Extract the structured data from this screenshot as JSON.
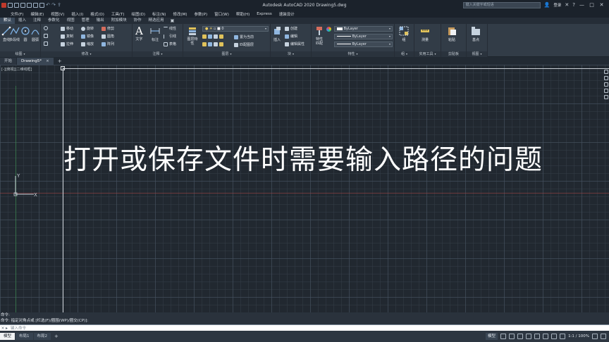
{
  "title_bar": {
    "app_title": "Autodesk AutoCAD 2020    Drawing5.dwg",
    "search_placeholder": "键入关键字或短语",
    "login_label": "登录",
    "help_glyph": "?",
    "minimize_glyph": "—",
    "maximize_glyph": "□",
    "close_glyph": "✕"
  },
  "menu_bar": {
    "items": [
      "文件(F)",
      "编辑(E)",
      "视图(V)",
      "插入(I)",
      "格式(O)",
      "工具(T)",
      "绘图(D)",
      "标注(N)",
      "修改(M)",
      "参数(P)",
      "窗口(W)",
      "帮助(H)",
      "Express",
      "速装设计"
    ]
  },
  "ribbon_tabs": {
    "items": [
      "默认",
      "插入",
      "注释",
      "参数化",
      "视图",
      "管理",
      "输出",
      "附加模块",
      "协作",
      "精选应用"
    ],
    "active_index": 0,
    "toggle_glyph": "▣"
  },
  "ribbon": {
    "draw": {
      "label": "绘图",
      "line": "直线",
      "polyline": "多段线",
      "circle": "圆",
      "arc": "圆弧"
    },
    "modify": {
      "label": "修改",
      "move": "移动",
      "rotate": "旋转",
      "trim": "修剪",
      "copy": "复制",
      "mirror": "镜像",
      "fillet": "圆角",
      "stretch": "拉伸",
      "scale": "缩放",
      "array": "阵列"
    },
    "annotation": {
      "label": "注释",
      "text": "文字",
      "dimension": "标注",
      "linear": "线性",
      "leader": "引线",
      "table": "表格"
    },
    "layers": {
      "label": "图层",
      "layer_properties": "图层特性",
      "current_layer": "0",
      "set_current": "置为当前",
      "match_layer": "匹配图层"
    },
    "block": {
      "label": "块",
      "insert": "插入",
      "create": "创建",
      "edit": "编辑",
      "edit_attributes": "编辑属性"
    },
    "properties": {
      "label": "特性",
      "match": "特性匹配",
      "color": "ByLayer",
      "linetype": "ByLayer",
      "lineweight": "ByLayer"
    },
    "groups": {
      "label": "组",
      "group": "组"
    },
    "utilities": {
      "label": "实用工具",
      "measure": "测量"
    },
    "clipboard": {
      "label": "剪贴板",
      "paste": "粘贴"
    },
    "view": {
      "label": "视图",
      "base": "基点"
    }
  },
  "file_tabs": {
    "items": [
      {
        "label": "开始",
        "active": false
      },
      {
        "label": "Drawing5*",
        "active": true
      }
    ],
    "close_glyph": "×",
    "add_glyph": "+"
  },
  "canvas": {
    "viewport_label": "[-][俯视][二维线框]",
    "overlay_text": "打开或保存文件时需要输入路径的问题",
    "ucs_x_label": "X",
    "ucs_y_label": "Y"
  },
  "command": {
    "history": [
      "命令:",
      "命令: 指定对角点或 [栏选(F)/圈围(WP)/圈交(CP)]:"
    ],
    "input_placeholder": "键入命令",
    "close_glyph": "×",
    "prompt_glyph": "▸"
  },
  "status_bar": {
    "layout_tabs": [
      {
        "label": "模型",
        "active": true
      },
      {
        "label": "布局1",
        "active": false
      },
      {
        "label": "布局2",
        "active": false
      }
    ],
    "add_glyph": "+",
    "model_label": "模型",
    "scale_label": "1:1 / 100%"
  },
  "colors": {
    "canvas_bg": "#212830",
    "ribbon_bg": "#323c47",
    "accent": "#3b4a5b"
  }
}
